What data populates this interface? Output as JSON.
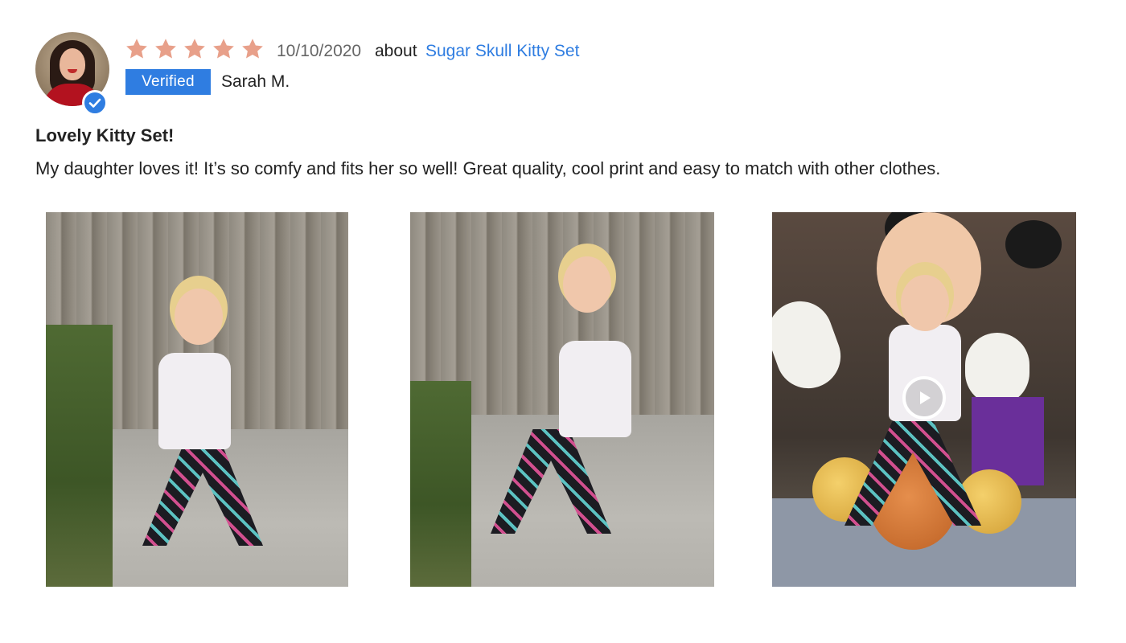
{
  "review": {
    "rating": 5,
    "rating_max": 5,
    "date": "10/10/2020",
    "about_label": "about",
    "product_name": "Sugar Skull Kitty Set",
    "verified_label": "Verified",
    "author": "Sarah M.",
    "title": "Lovely Kitty Set!",
    "body": "My daughter loves it! It’s so comfy and fits her so well! Great quality, cool print and easy to match with other clothes.",
    "media": [
      {
        "type": "image"
      },
      {
        "type": "image"
      },
      {
        "type": "video"
      }
    ]
  },
  "colors": {
    "star": "#e8a08a",
    "accent": "#2f7de1",
    "text": "#222222",
    "muted": "#666666"
  },
  "icons": {
    "star": "star-icon",
    "verified_check": "check-circle-icon",
    "play": "play-icon"
  }
}
